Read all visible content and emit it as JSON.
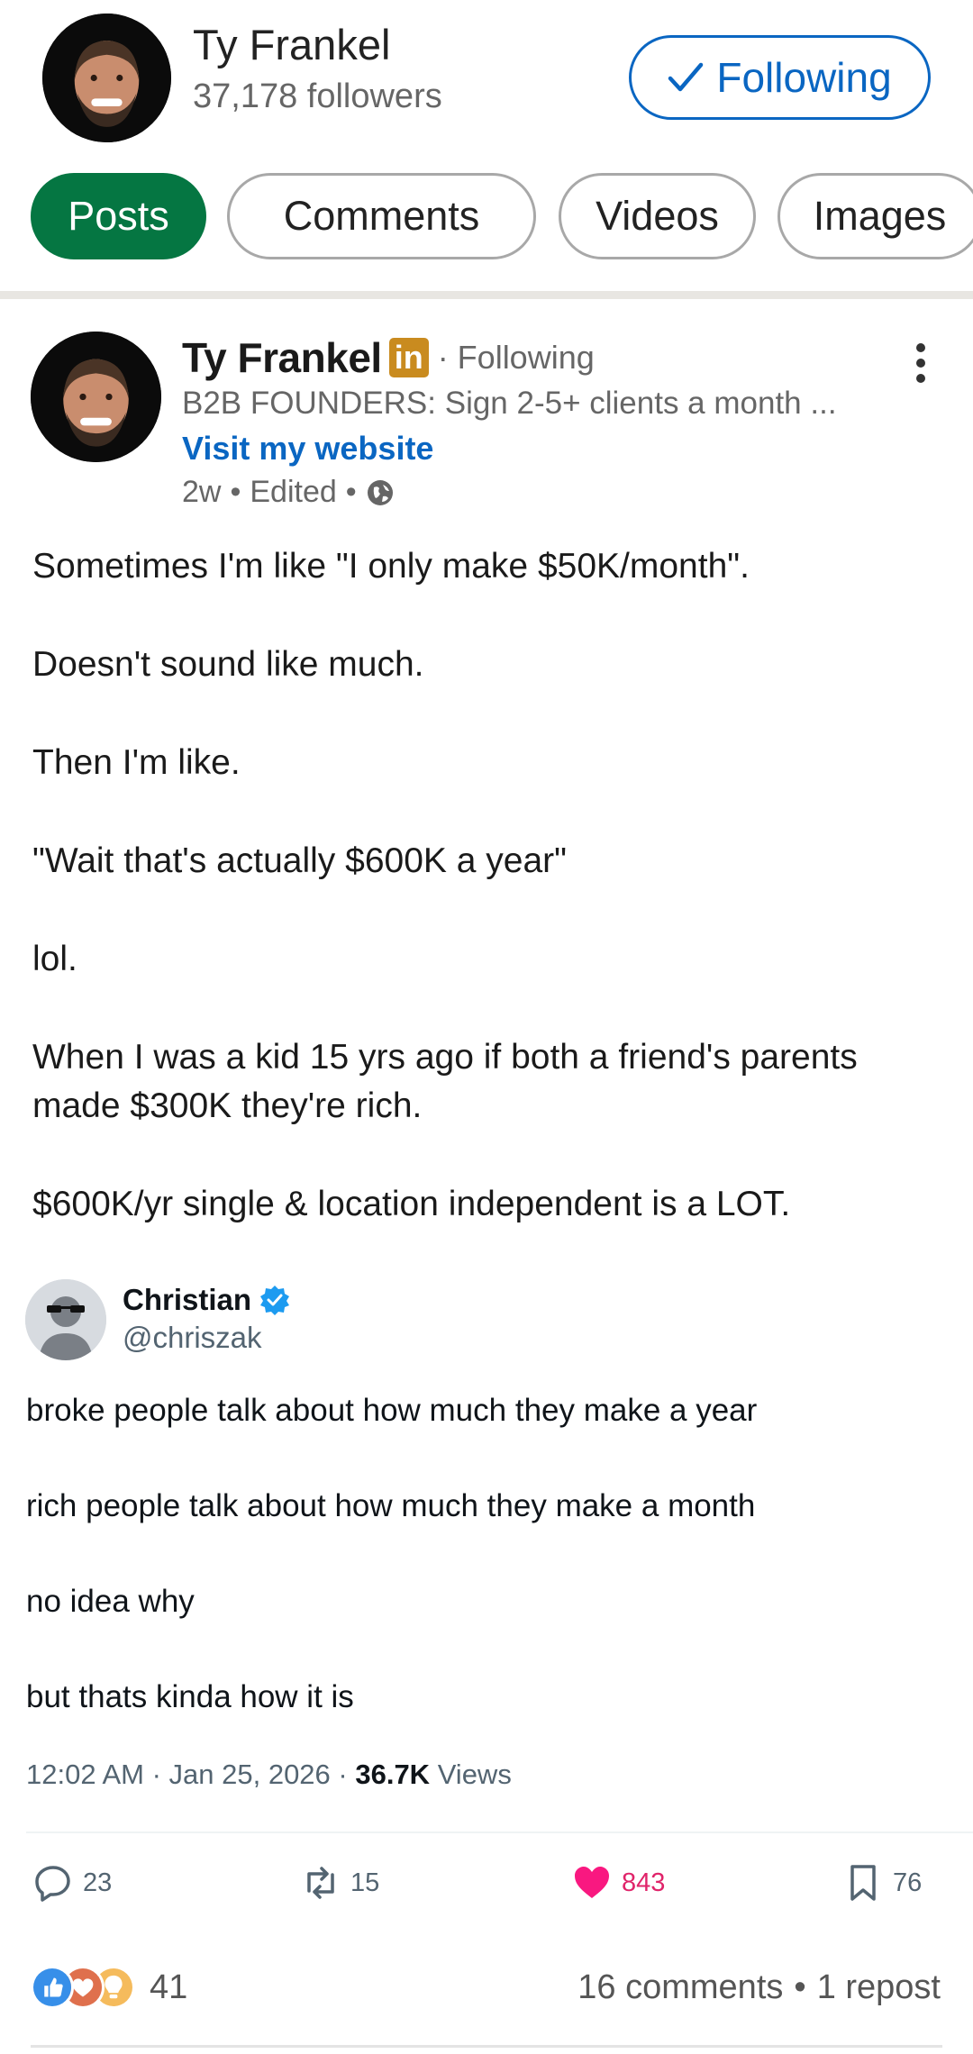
{
  "profile": {
    "name": "Ty Frankel",
    "followers": "37,178 followers",
    "follow_label": "Following"
  },
  "tabs": [
    {
      "label": "Posts",
      "active": true
    },
    {
      "label": "Comments",
      "active": false
    },
    {
      "label": "Videos",
      "active": false
    },
    {
      "label": "Images",
      "active": false
    }
  ],
  "post": {
    "author": "Ty Frankel",
    "badge": "in",
    "follow_status": "· Following",
    "headline": "B2B FOUNDERS: Sign 2-5+ clients a month ...",
    "website_link": "Visit my website",
    "meta_time": "2w",
    "meta_edited": "Edited",
    "sep": "•",
    "body": [
      "Sometimes I'm like \"I only make $50K/month\".",
      "Doesn't sound like much.",
      "Then I'm like.",
      "\"Wait that's actually $600K a year\"",
      "lol.",
      "When I was a kid 15 yrs ago if both a friend's parents made $300K they're rich.",
      "$600K/yr single & location independent is a LOT."
    ]
  },
  "tweet": {
    "name": "Christian",
    "handle": "@chriszak",
    "body": [
      "broke people talk about how much they make a year",
      "rich people talk about how much they make a month",
      "no idea why",
      "but thats kinda how it is"
    ],
    "timestamp": "12:02 AM · Jan 25, 2026 · ",
    "views_count": "36.7K",
    "views_label": " Views",
    "replies": "23",
    "retweets": "15",
    "likes": "843",
    "bookmarks": "76",
    "like_color": "#f91880"
  },
  "engagement": {
    "reactions_count": "41",
    "comments": "16 comments",
    "sep": "•",
    "reposts": "1 repost"
  },
  "colors": {
    "linkedin_blue": "#0a66c2",
    "active_tab_green": "#057642"
  }
}
